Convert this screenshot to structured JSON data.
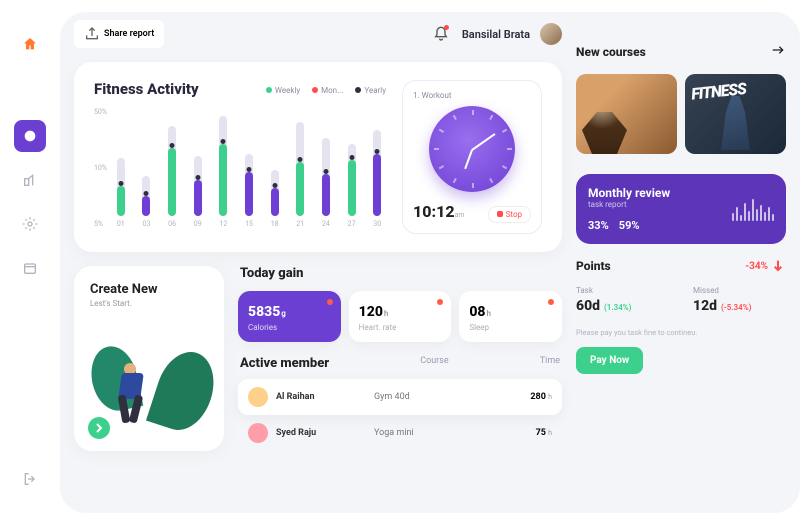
{
  "sidebar": {
    "logout_label": "Logout"
  },
  "topbar": {
    "share": "Share report",
    "user": "Bansilal Brata"
  },
  "fitness": {
    "title": "Fitness Activity",
    "legend": {
      "weekly": "Weekly",
      "monthly": "Mon...",
      "yearly": "Yearly"
    },
    "ylabels": [
      "5%",
      "10%",
      "50%"
    ],
    "xlabels": [
      "01",
      "03",
      "06",
      "09",
      "12",
      "15",
      "18",
      "21",
      "24",
      "27",
      "30"
    ]
  },
  "workout": {
    "title": "1.  Workout",
    "time": "10:12",
    "ampm": "am",
    "stop": "Stop"
  },
  "create": {
    "title": "Create New",
    "sub": "Lest's Start."
  },
  "today": {
    "title": "Today gain",
    "stats": [
      {
        "value": "5835",
        "unit": "g",
        "label": "Calories"
      },
      {
        "value": "120",
        "unit": "h",
        "label": "Heart. rate"
      },
      {
        "value": "08",
        "unit": "h",
        "label": "Sleep"
      }
    ],
    "active_title": "Active member",
    "cols": {
      "course": "Course",
      "time": "Time"
    },
    "members": [
      {
        "name": "Al Raihan",
        "course": "Gym 40d",
        "time": "280",
        "unit": "h"
      },
      {
        "name": "Syed Raju",
        "course": "Yoga mini",
        "time": "75",
        "unit": "h"
      }
    ]
  },
  "courses": {
    "title": "New courses",
    "fitness_text": "FITNESS"
  },
  "review": {
    "title": "Monthly review",
    "sub": "task report",
    "pct1": "33%",
    "pct2": "59%"
  },
  "points": {
    "title": "Points",
    "change": "-34%",
    "task": {
      "label": "Task",
      "value": "60d",
      "sub": "(1.34%)"
    },
    "missed": {
      "label": "Missed",
      "value": "12d",
      "sub": "(-5.34%)"
    },
    "fine": "Please pay you task fine to contineu.",
    "pay": "Pay Now"
  },
  "chart_data": {
    "type": "bar",
    "title": "Fitness Activity",
    "categories": [
      "01",
      "03",
      "06",
      "09",
      "12",
      "15",
      "18",
      "21",
      "24",
      "27",
      "30"
    ],
    "series": [
      {
        "name": "Weekly",
        "color": "#3dcf8c"
      },
      {
        "name": "Monthly",
        "color": "#ff4d4d"
      },
      {
        "name": "Yearly",
        "color": "#2f2f3f"
      }
    ],
    "ylabels": [
      "5%",
      "10%",
      "50%"
    ],
    "bars": [
      {
        "bg": 58,
        "fg": 30,
        "c": "green"
      },
      {
        "bg": 40,
        "fg": 20,
        "c": "purple"
      },
      {
        "bg": 90,
        "fg": 68,
        "c": "green"
      },
      {
        "bg": 60,
        "fg": 36,
        "c": "purple"
      },
      {
        "bg": 100,
        "fg": 72,
        "c": "green"
      },
      {
        "bg": 62,
        "fg": 44,
        "c": "purple"
      },
      {
        "bg": 46,
        "fg": 28,
        "c": "purple"
      },
      {
        "bg": 94,
        "fg": 54,
        "c": "green"
      },
      {
        "bg": 78,
        "fg": 42,
        "c": "purple"
      },
      {
        "bg": 72,
        "fg": 56,
        "c": "green"
      },
      {
        "bg": 86,
        "fg": 62,
        "c": "purple"
      }
    ]
  }
}
